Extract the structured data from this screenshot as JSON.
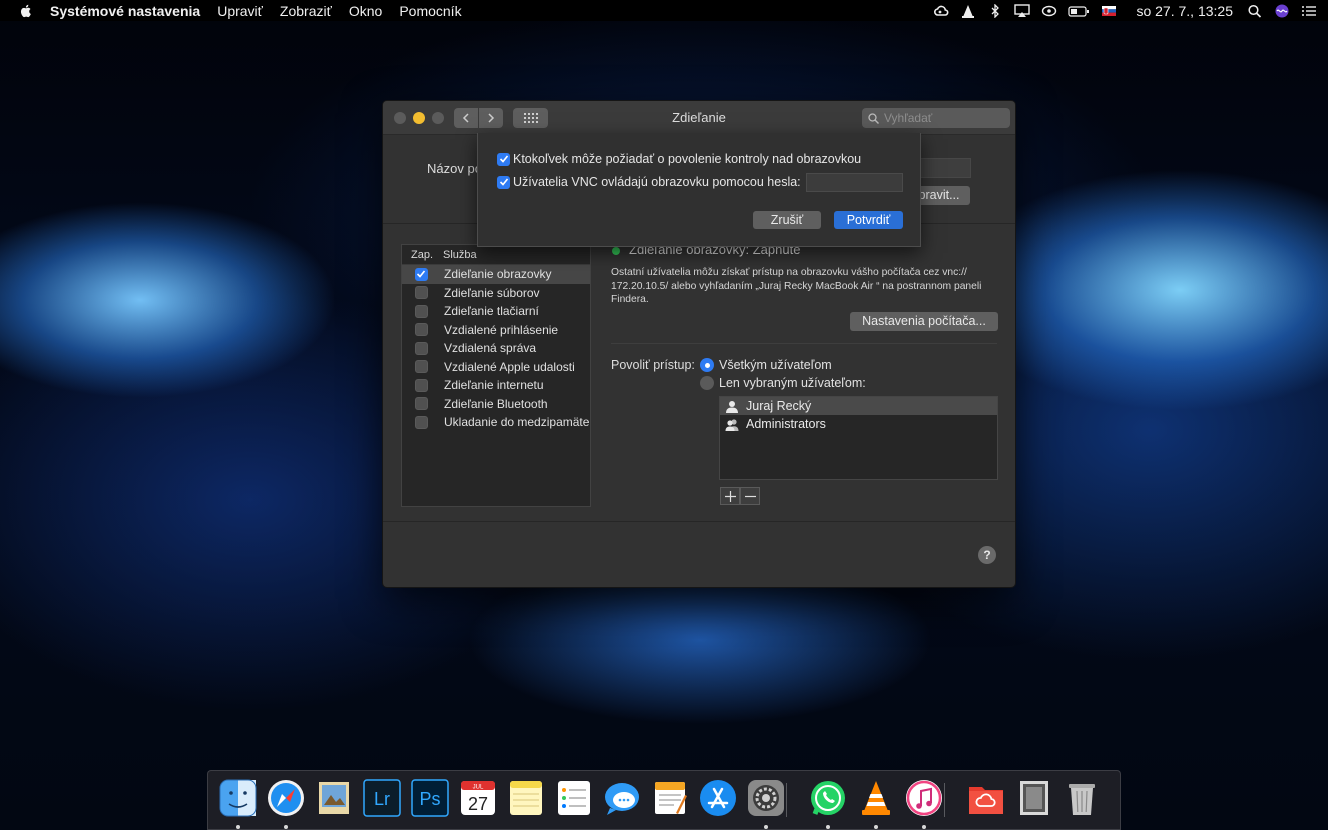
{
  "menubar": {
    "app_name": "Systémové nastavenia",
    "menus": [
      "Upraviť",
      "Zobraziť",
      "Okno",
      "Pomocník"
    ],
    "clock": "so 27. 7.,  13:25",
    "status_icons": [
      "creative-cloud-icon",
      "vlc-icon",
      "bluetooth-icon",
      "airplay-icon",
      "sync-icon",
      "battery-icon",
      "slovak-flag-icon",
      "spotlight-icon",
      "siri-icon",
      "notification-center-icon"
    ]
  },
  "window": {
    "title": "Zdieľanie",
    "search_placeholder": "Vyhľadať",
    "computer_name_label": "Názov po",
    "edit_button": "pravit...",
    "services_header": {
      "col_on": "Zap.",
      "col_service": "Služba"
    },
    "services": [
      {
        "label": "Zdieľanie obrazovky",
        "checked": true,
        "selected": true
      },
      {
        "label": "Zdieľanie súborov",
        "checked": false
      },
      {
        "label": "Zdieľanie tlačiarní",
        "checked": false
      },
      {
        "label": "Vzdialené prihlásenie",
        "checked": false
      },
      {
        "label": "Vzdialená správa",
        "checked": false
      },
      {
        "label": "Vzdialené Apple udalosti",
        "checked": false
      },
      {
        "label": "Zdieľanie internetu",
        "checked": false
      },
      {
        "label": "Zdieľanie Bluetooth",
        "checked": false
      },
      {
        "label": "Ukladanie do medzipamäte",
        "checked": false
      }
    ],
    "status_text": "Zdieľanie obrazovky: Zapnuté",
    "description": "Ostatní užívatelia môžu získať prístup na obrazovku vášho počítača cez vnc:// 172.20.10.5/ alebo vyhľadaním „Juraj Recky MacBook Air “ na postrannom paneli Findera.",
    "computer_settings_button": "Nastavenia počítača...",
    "allow_access_label": "Povoliť prístup:",
    "radio_all": "Všetkým užívateľom",
    "radio_selected": "Len vybraným užívateľom:",
    "radio_value": "all",
    "users": [
      {
        "name": "Juraj Recký",
        "icon": "user-icon",
        "selected": true
      },
      {
        "name": "Administrators",
        "icon": "group-icon",
        "selected": false
      }
    ],
    "help_label": "?"
  },
  "sheet": {
    "option1": "Ktokoľvek môže požiadať o povolenie kontroly nad obrazovkou",
    "option1_checked": true,
    "option2": "Užívatelia VNC ovládajú obrazovku pomocou hesla:",
    "option2_checked": true,
    "password_value": "",
    "cancel_button": "Zrušiť",
    "confirm_button": "Potvrdiť"
  },
  "dock": {
    "apps": [
      {
        "name": "Finder",
        "icon": "finder-icon",
        "running": true
      },
      {
        "name": "Safari",
        "icon": "safari-icon",
        "running": true
      },
      {
        "name": "Preview",
        "icon": "preview-icon",
        "running": false
      },
      {
        "name": "Lightroom",
        "icon": "lightroom-icon",
        "label": "Lr",
        "running": false
      },
      {
        "name": "Photoshop",
        "icon": "photoshop-icon",
        "label": "Ps",
        "running": false
      },
      {
        "name": "Calendar",
        "icon": "calendar-icon",
        "label": "27",
        "month": "JUL",
        "running": false
      },
      {
        "name": "Notes",
        "icon": "notes-icon",
        "running": false
      },
      {
        "name": "Reminders",
        "icon": "reminders-icon",
        "running": false
      },
      {
        "name": "Messages",
        "icon": "messages-icon",
        "running": false
      },
      {
        "name": "Pages",
        "icon": "pages-icon",
        "running": false
      },
      {
        "name": "App Store",
        "icon": "app-store-icon",
        "running": false
      },
      {
        "name": "System Preferences",
        "icon": "system-preferences-icon",
        "running": true
      },
      {
        "name": "WhatsApp",
        "icon": "whatsapp-icon",
        "running": true
      },
      {
        "name": "VLC",
        "icon": "vlc-icon",
        "running": true
      },
      {
        "name": "iTunes",
        "icon": "itunes-icon",
        "running": true
      },
      {
        "name": "Creative Cloud Files",
        "icon": "creative-cloud-folder-icon",
        "running": false
      },
      {
        "name": "Downloads",
        "icon": "downloads-stack-icon",
        "running": false
      },
      {
        "name": "Trash",
        "icon": "trash-icon",
        "running": false
      }
    ]
  },
  "colors": {
    "accent": "#2e7bf3",
    "status_on": "#34c759",
    "window_bg": "#323232"
  }
}
